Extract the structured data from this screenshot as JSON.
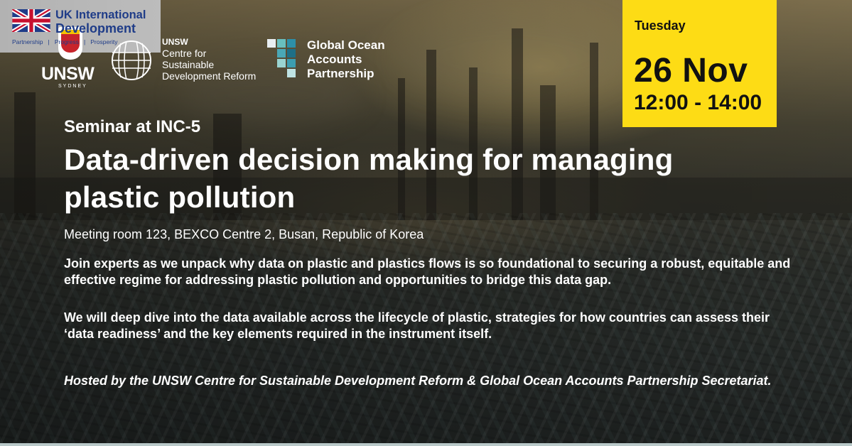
{
  "logos": {
    "unsw": {
      "wordmark": "UNSW",
      "city": "SYDNEY"
    },
    "csdr": {
      "org": "UNSW",
      "lines": [
        "Centre for",
        "Sustainable",
        "Development Reform"
      ]
    },
    "goap": {
      "lines": [
        "Global Ocean",
        "Accounts",
        "Partnership"
      ]
    },
    "uk_intl_dev": {
      "lines": [
        "UK International",
        "Development"
      ],
      "tagline": "Partnership   |   Progress   |   Prosperity"
    }
  },
  "date": {
    "day": "Tuesday",
    "date": "26 Nov",
    "time": "12:00 - 14:00"
  },
  "event": {
    "subtitle": "Seminar at INC-5",
    "title": "Data-driven decision making for managing plastic pollution",
    "location": "Meeting room 123, BEXCO Centre 2, Busan, Republic of Korea",
    "paragraphs": [
      "Join experts as we unpack why data on plastic and plastics flows is so foundational to securing a robust, equitable and effective regime for addressing plastic pollution and opportunities to bridge this data gap.",
      "We will deep dive into the data available across the lifecycle of plastic, strategies for how countries can assess their ‘data readiness’ and the key elements required in the instrument itself."
    ],
    "hosted_by": "Hosted by the UNSW Centre for Sustainable Development Reform & Global Ocean Accounts Partnership Secretariat."
  },
  "colors": {
    "accent_yellow": "#fddc15",
    "uk_blue": "#1f3c88",
    "unsw_red": "#c8242b"
  }
}
